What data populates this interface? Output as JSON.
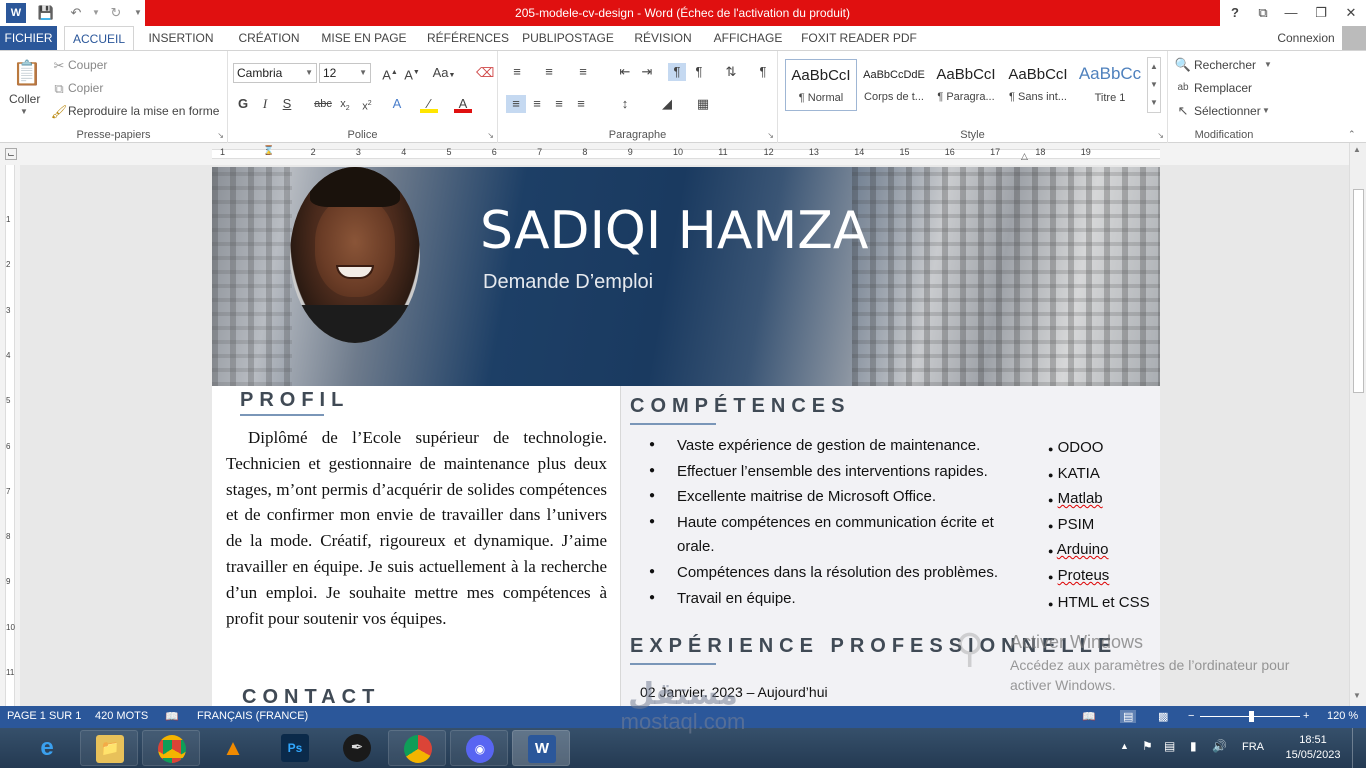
{
  "window": {
    "title": "205-modele-cv-design  -  Word (Échec de l'activation du produit)"
  },
  "titlebar_buttons": {
    "help": "?",
    "restore_ribbon": "⧉",
    "minimize": "—",
    "maximize": "❐",
    "close": "✕"
  },
  "tabs": [
    {
      "label": "FICHIER"
    },
    {
      "label": "ACCUEIL"
    },
    {
      "label": "INSERTION"
    },
    {
      "label": "CRÉATION"
    },
    {
      "label": "MISE EN PAGE"
    },
    {
      "label": "RÉFÉRENCES"
    },
    {
      "label": "PUBLIPOSTAGE"
    },
    {
      "label": "RÉVISION"
    },
    {
      "label": "AFFICHAGE"
    },
    {
      "label": "FOXIT READER PDF"
    }
  ],
  "account": {
    "signin": "Connexion"
  },
  "ribbon": {
    "clipboard": {
      "paste": "Coller",
      "cut": "Couper",
      "copy": "Copier",
      "format_painter": "Reproduire la mise en forme",
      "group": "Presse-papiers"
    },
    "font": {
      "family": "Cambria",
      "size": "12",
      "group": "Police"
    },
    "paragraph": {
      "group": "Paragraphe"
    },
    "styles": {
      "group": "Style",
      "items": [
        {
          "sample": "AaBbCcI",
          "name": "¶ Normal"
        },
        {
          "sample": "AaBbCcDdE",
          "name": "Corps de t..."
        },
        {
          "sample": "AaBbCcI",
          "name": "¶ Paragra..."
        },
        {
          "sample": "AaBbCcI",
          "name": "¶ Sans int..."
        },
        {
          "sample": "AaBbCc",
          "name": "Titre 1"
        }
      ]
    },
    "editing": {
      "find": "Rechercher",
      "replace": "Remplacer",
      "select": "Sélectionner",
      "group": "Modification"
    }
  },
  "ruler": {
    "numbers": [
      "1",
      "1",
      "2",
      "3",
      "4",
      "5",
      "6",
      "7",
      "8",
      "9",
      "10",
      "11",
      "12",
      "13",
      "14",
      "15",
      "16",
      "17",
      "18",
      "19"
    ]
  },
  "vruler": {
    "numbers": [
      "1",
      "2",
      "3",
      "4",
      "5",
      "6",
      "7",
      "8",
      "9",
      "10",
      "11"
    ]
  },
  "cv": {
    "name": "SADIQI HAMZA",
    "subtitle": "Demande D’emploi",
    "profile_heading": "PROFIL",
    "profile_text": "Diplômé de l’Ecole supérieur de technologie. Technicien et gestionnaire de maintenance plus deux stages, m’ont permis d’acquérir de solides compétences et de confirmer mon envie de travailler dans l’univers de la mode. Créatif, rigoureux et dynamique. J’aime travailler en équipe. Je suis actuellement à la recherche d’un emploi. Je souhaite mettre mes compétences à profit pour soutenir vos équipes.",
    "contact_heading": "CONTACT",
    "skills_heading": "COMPÉTENCES",
    "skills": [
      "Vaste expérience de gestion de maintenance.",
      "Effectuer l’ensemble des interventions rapides.",
      "Excellente maitrise de Microsoft Office.",
      "Haute compétences en communication écrite et",
      "orale.",
      "Compétences dans la résolution des problèmes.",
      "Travail en équipe."
    ],
    "tools": [
      "ODOO",
      "KATIA",
      "Matlab",
      "PSIM",
      "Arduino",
      "Proteus",
      "HTML et CSS"
    ],
    "experience_heading": "EXPÉRIENCE PROFESSIONNELLE",
    "experience_date": "02 Janvier. 2023 – Aujourd’hui"
  },
  "activation": {
    "title": "Activer Windows",
    "text": "Accédez aux paramètres de l’ordinateur pour activer Windows."
  },
  "statusbar": {
    "page": "PAGE 1 SUR 1",
    "words": "420 MOTS",
    "language": "FRANÇAIS (FRANCE)",
    "zoom": "120 %"
  },
  "watermark": {
    "arabic": "مستقل",
    "latin": "mostaql.com"
  },
  "taskbar": {
    "lang": "FRA",
    "time": "18:51",
    "date": "15/05/2023"
  },
  "colors": {
    "word_blue": "#2b579a",
    "title_red": "#e01010",
    "heading": "#404a55"
  }
}
